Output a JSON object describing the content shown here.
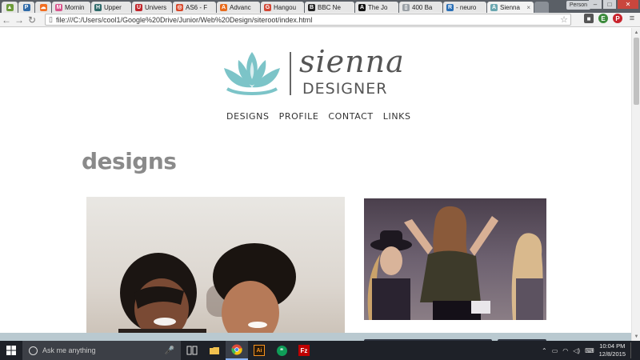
{
  "browser": {
    "tabs": [
      {
        "label": "",
        "favicon": "android-icon",
        "color": "#6c9b3a",
        "pinned": true
      },
      {
        "label": "",
        "favicon": "p-icon",
        "color": "#2f6aa8",
        "pinned": true
      },
      {
        "label": "",
        "favicon": "soundcloud-icon",
        "color": "#f26f23",
        "pinned": true
      },
      {
        "label": "Mornin",
        "favicon": "m-icon",
        "color": "#d8558c"
      },
      {
        "label": "Upper",
        "favicon": "h-icon",
        "color": "#2f6b6b"
      },
      {
        "label": "Univers",
        "favicon": "u-icon",
        "color": "#c1272d"
      },
      {
        "label": "AS6 - F",
        "favicon": "circle-icon",
        "color": "#d9482b"
      },
      {
        "label": "Advanc",
        "favicon": "a-icon",
        "color": "#e96b1c"
      },
      {
        "label": "Hangou",
        "favicon": "g-icon",
        "color": "#d34836"
      },
      {
        "label": "BBC Ne",
        "favicon": "bbc-icon",
        "color": "#222222"
      },
      {
        "label": "The Jo",
        "favicon": "a-icon",
        "color": "#111111"
      },
      {
        "label": "400 Ba",
        "favicon": "page-icon",
        "color": "#9aa0a6"
      },
      {
        "label": "- neuro",
        "favicon": "r-icon",
        "color": "#2a6fb6"
      },
      {
        "label": "Sienna",
        "favicon": "a-icon",
        "color": "#6aa7b0",
        "active": true
      }
    ],
    "profile_label": "Person",
    "url": "file:///C:/Users/cool1/Google%20Drive/Junior/Web%20Design/siteroot/index.html"
  },
  "site": {
    "logo_script": "sienna",
    "logo_sub": "DESIGNER",
    "nav": [
      "DESIGNS",
      "PROFILE",
      "CONTACT",
      "LINKS"
    ],
    "heading": "designs",
    "accent_color": "#7cc4c8"
  },
  "taskbar": {
    "search_placeholder": "Ask me anything",
    "apps": [
      "task-view-icon",
      "file-explorer-icon",
      "chrome-icon",
      "illustrator-icon",
      "hangouts-icon",
      "filezilla-icon"
    ],
    "time": "10:04 PM",
    "date": "12/8/2015"
  }
}
